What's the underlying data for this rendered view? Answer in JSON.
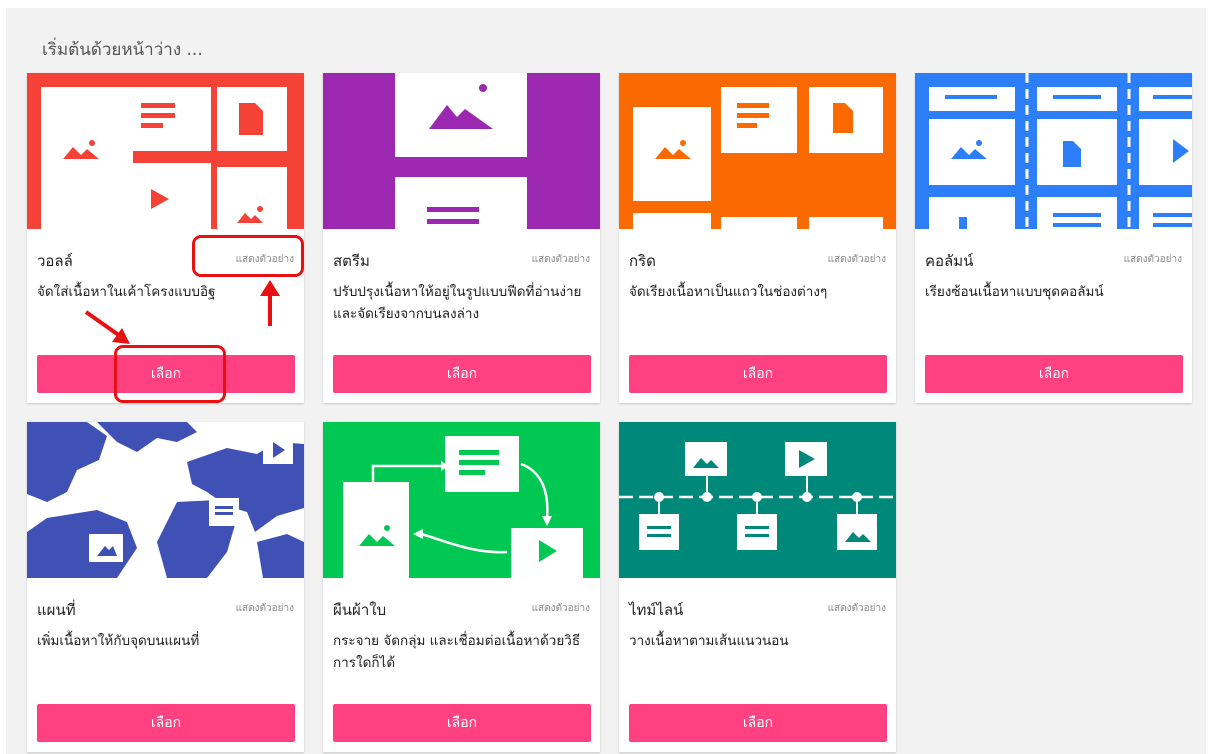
{
  "heading": "เริ่มต้นด้วยหน้าว่าง ...",
  "accent_button_color": "#ff4081",
  "annotation_color": "#e81010",
  "cards": [
    {
      "title": "วอลล์",
      "preview": "แสดงตัวอย่าง",
      "description": "จัดใส่เนื้อหาในเค้าโครงแบบอิฐ",
      "button": "เลือก",
      "thumb_color": "#f44336"
    },
    {
      "title": "สตรีม",
      "preview": "แสดงตัวอย่าง",
      "description": "ปรับปรุงเนื้อหาให้อยู่ในรูปแบบฟีดที่อ่านง่ายและจัดเรียงจากบนลงล่าง",
      "button": "เลือก",
      "thumb_color": "#9c27b0"
    },
    {
      "title": "กริด",
      "preview": "แสดงตัวอย่าง",
      "description": "จัดเรียงเนื้อหาเป็นแถวในช่องต่างๆ",
      "button": "เลือก",
      "thumb_color": "#fb6a00"
    },
    {
      "title": "คอลัมน์",
      "preview": "แสดงตัวอย่าง",
      "description": "เรียงซ้อนเนื้อหาแบบชุดคอลัมน์",
      "button": "เลือก",
      "thumb_color": "#2d7ff9"
    },
    {
      "title": "แผนที่",
      "preview": "แสดงตัวอย่าง",
      "description": "เพิ่มเนื้อหาให้กับจุดบนแผนที่",
      "button": "เลือก",
      "thumb_color": "#3f51b5"
    },
    {
      "title": "ผืนผ้าใบ",
      "preview": "แสดงตัวอย่าง",
      "description": "กระจาย จัดกลุ่ม และเชื่อมต่อเนื้อหาด้วยวิธีการใดก็ได้",
      "button": "เลือก",
      "thumb_color": "#00c853"
    },
    {
      "title": "ไทม์ไลน์",
      "preview": "แสดงตัวอย่าง",
      "description": "วางเนื้อหาตามเส้นแนวนอน",
      "button": "เลือก",
      "thumb_color": "#00897b"
    }
  ]
}
